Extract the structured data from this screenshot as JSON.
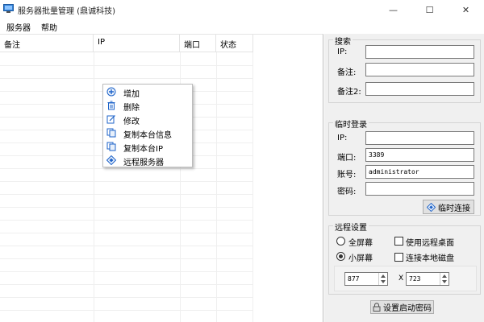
{
  "window": {
    "title": "服务器批量管理 (鼎诚科技)",
    "minimize": "—",
    "maximize": "☐",
    "close": "✕"
  },
  "menu": {
    "items": [
      "服务器",
      "帮助"
    ]
  },
  "table": {
    "columns": [
      "备注",
      "IP",
      "端口",
      "状态"
    ]
  },
  "context_menu": {
    "items": [
      {
        "label": "增加",
        "icon": "add-icon"
      },
      {
        "label": "删除",
        "icon": "delete-icon"
      },
      {
        "label": "修改",
        "icon": "edit-icon"
      },
      {
        "label": "复制本台信息",
        "icon": "copy-icon"
      },
      {
        "label": "复制本台IP",
        "icon": "copy-icon"
      },
      {
        "label": "远程服务器",
        "icon": "remote-icon"
      }
    ]
  },
  "search": {
    "title": "搜索",
    "ip_label": "IP:",
    "note_label": "备注:",
    "note2_label": "备注2:",
    "ip_value": "",
    "note_value": "",
    "note2_value": ""
  },
  "temp_login": {
    "title": "临时登录",
    "ip_label": "IP:",
    "port_label": "端口:",
    "account_label": "账号:",
    "password_label": "密码:",
    "ip_value": "",
    "port_value": "3389",
    "account_value": "administrator",
    "password_value": "",
    "connect_button": "临时连接"
  },
  "remote_settings": {
    "title": "远程设置",
    "fullscreen_label": "全屏幕",
    "smallscreen_label": "小屏幕",
    "use_remote_desktop_label": "使用远程桌面",
    "connect_local_disk_label": "连接本地磁盘",
    "width_value": "877",
    "x_label": "X",
    "height_value": "723",
    "selected_mode": "小屏幕"
  },
  "boot_password_button": "设置启动密码",
  "colors": {
    "accent": "#1e63c9",
    "panel": "#f0f0f0"
  }
}
